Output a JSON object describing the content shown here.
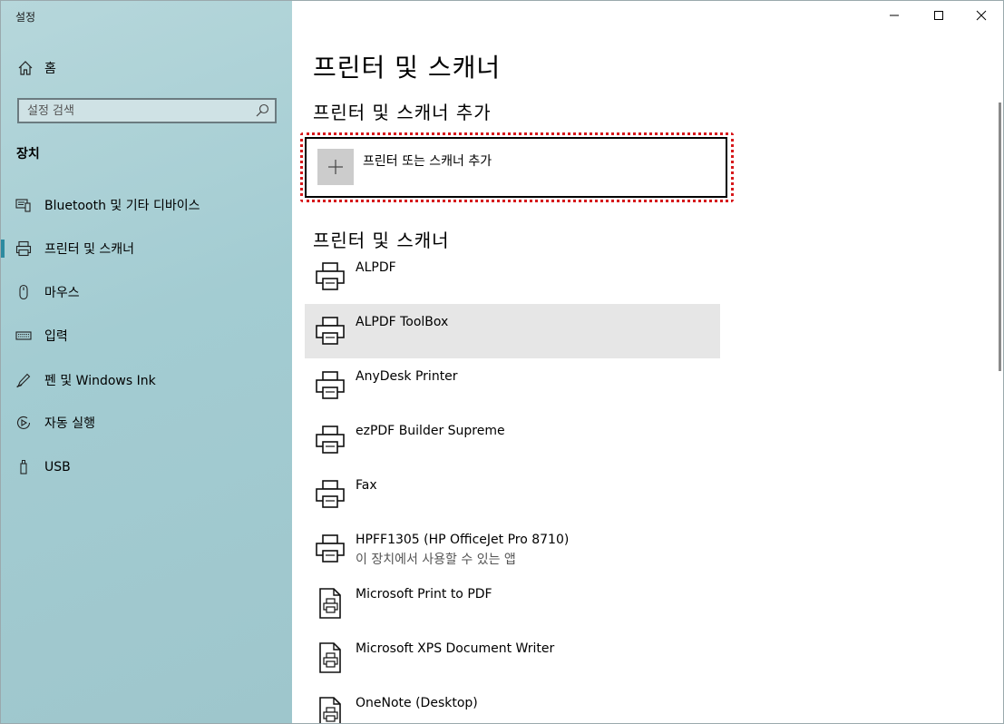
{
  "window": {
    "title": "설정"
  },
  "sidebar": {
    "home_label": "홈",
    "search_placeholder": "설정 검색",
    "section_header": "장치",
    "items": [
      {
        "label": "Bluetooth 및 기타 디바이스",
        "icon": "bluetooth-devices-icon"
      },
      {
        "label": "프린터 및 스캐너",
        "icon": "printer-icon",
        "active": true
      },
      {
        "label": "마우스",
        "icon": "mouse-icon"
      },
      {
        "label": "입력",
        "icon": "keyboard-icon"
      },
      {
        "label": "펜 및 Windows Ink",
        "icon": "pen-icon"
      },
      {
        "label": "자동 실행",
        "icon": "autoplay-icon"
      },
      {
        "label": "USB",
        "icon": "usb-icon"
      }
    ]
  },
  "main": {
    "title": "프린터 및 스캐너",
    "add_section_title": "프린터 및 스캐너 추가",
    "add_button_label": "프린터 또는 스캐너 추가",
    "list_title": "프린터 및 스캐너",
    "printers": [
      {
        "name": "ALPDF",
        "sub": "",
        "icon": "printer-icon"
      },
      {
        "name": "ALPDF ToolBox",
        "sub": "",
        "icon": "printer-icon",
        "selected": true
      },
      {
        "name": "AnyDesk Printer",
        "sub": "",
        "icon": "printer-icon"
      },
      {
        "name": "ezPDF Builder Supreme",
        "sub": "",
        "icon": "printer-icon"
      },
      {
        "name": "Fax",
        "sub": "",
        "icon": "printer-icon"
      },
      {
        "name": "HPFF1305 (HP OfficeJet Pro 8710)",
        "sub": "이 장치에서 사용할 수 있는 앱",
        "icon": "printer-icon"
      },
      {
        "name": "Microsoft Print to PDF",
        "sub": "",
        "icon": "document-printer-icon"
      },
      {
        "name": "Microsoft XPS Document Writer",
        "sub": "",
        "icon": "document-printer-icon"
      },
      {
        "name": "OneNote (Desktop)",
        "sub": "",
        "icon": "document-printer-icon"
      }
    ]
  },
  "colors": {
    "sidebar_bg": "#a3ccd2",
    "accent": "#2d8ba0",
    "highlight_border": "#d7191c",
    "selected_row": "#e6e6e6"
  }
}
